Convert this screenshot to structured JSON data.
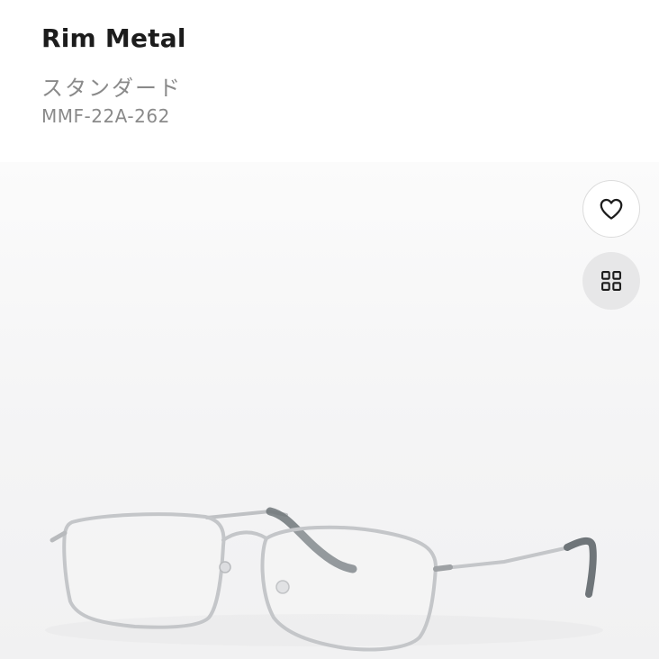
{
  "product": {
    "name": "Rim Metal",
    "type_label": "スタンダード",
    "model_code": "MMF-22A-262"
  },
  "actions": {
    "favorite_icon": "heart-icon",
    "gallery_icon": "grid-icon"
  },
  "colors": {
    "title": "#1c1c1c",
    "secondary_text": "#8a8a8a",
    "frame_metal": "#c4c6c9",
    "temple_tip": "#6f7579"
  }
}
